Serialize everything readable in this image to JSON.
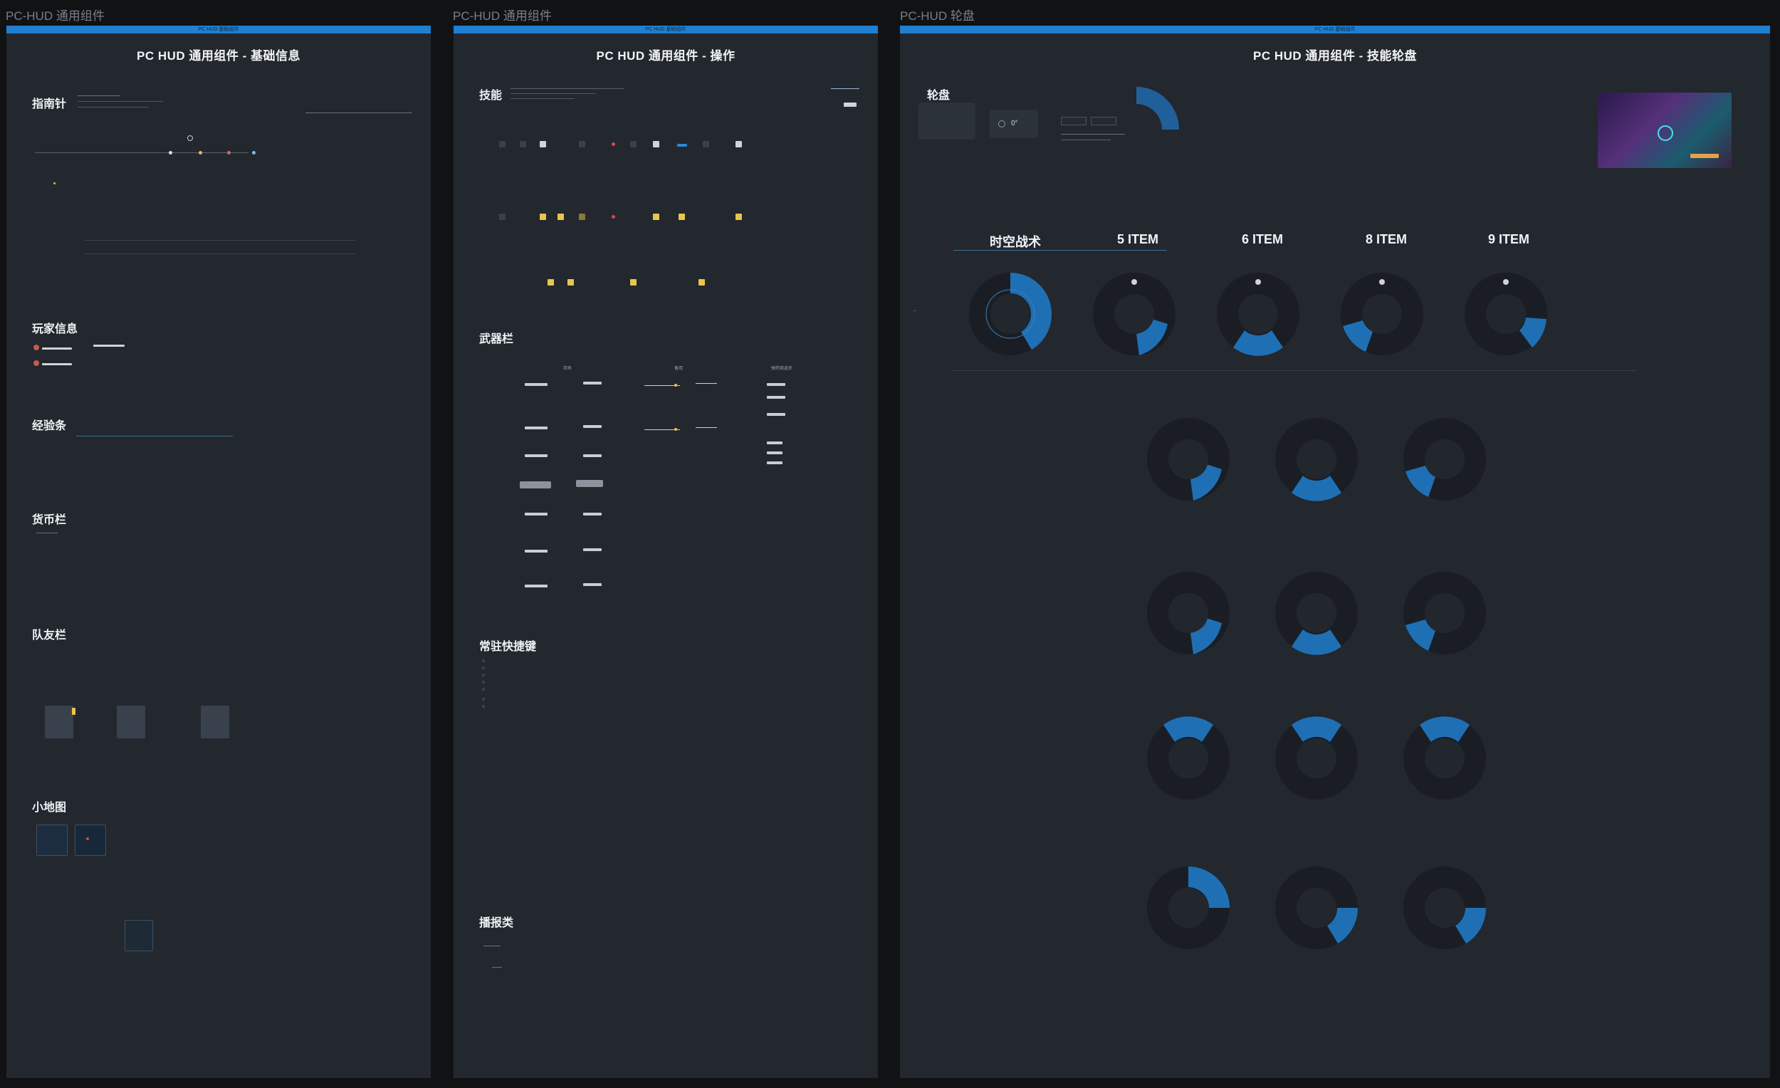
{
  "frames": [
    {
      "label": "PC-HUD 通用组件",
      "bar": "PC HUD 基础组件",
      "title": "PC HUD 通用组件 - 基础信息",
      "sections": [
        "指南针",
        "玩家信息",
        "经验条",
        "货币栏",
        "队友栏",
        "小地图"
      ]
    },
    {
      "label": "PC-HUD 通用组件",
      "bar": "PC HUD 基础组件",
      "title": "PC HUD 通用组件 - 操作",
      "sections": [
        "技能",
        "武器栏",
        "常驻快捷键",
        "播报类"
      ],
      "weapon_columns": [
        "持有",
        "备用",
        "弹药续返步"
      ]
    },
    {
      "label": "PC-HUD 轮盘",
      "bar": "PC HUD 基础组件",
      "title": "PC HUD 通用组件 - 技能轮盘",
      "sections": [
        "轮盘"
      ],
      "wheel_columns": [
        "时空战术",
        "5 ITEM",
        "6 ITEM",
        "8 ITEM",
        "9 ITEM"
      ],
      "degree": "0°"
    }
  ]
}
